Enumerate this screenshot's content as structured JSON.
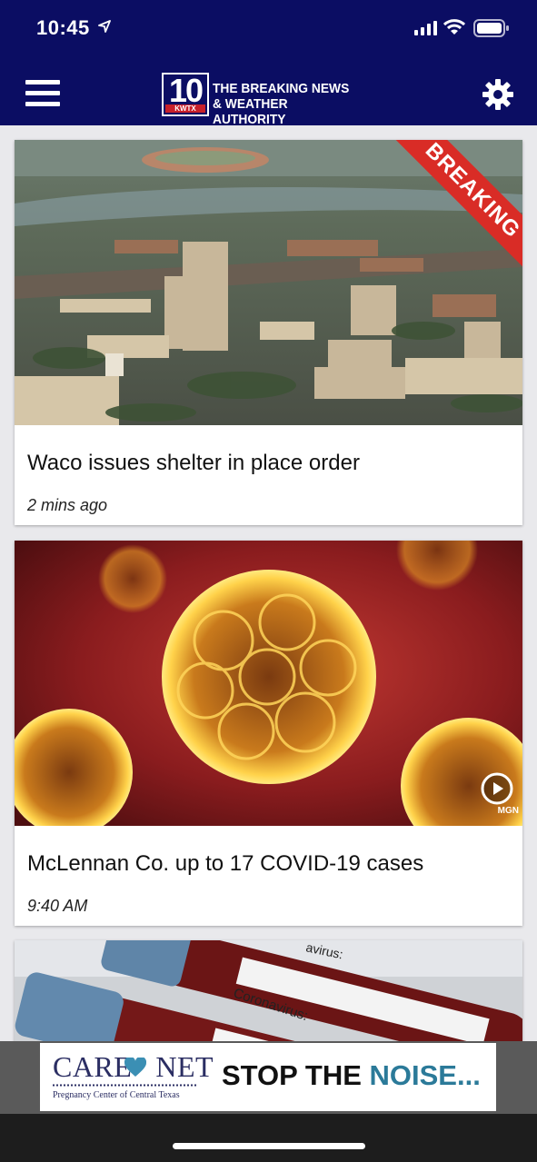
{
  "status_bar": {
    "time": "10:45"
  },
  "header": {
    "logo_number": "10",
    "logo_station": "KWTX",
    "logo_line1": "THE BREAKING NEWS",
    "logo_line2": "& WEATHER AUTHORITY",
    "menu_icon": "hamburger-menu-icon",
    "settings_icon": "gear-icon",
    "colors": {
      "bar": "#0b0d63",
      "breaking": "#d92c26"
    }
  },
  "stories": [
    {
      "badge": "BREAKING",
      "title": "Waco issues shelter in place order",
      "time": "2 mins ago"
    },
    {
      "title": "McLennan Co. up to 17 COVID-19 cases",
      "time": "9:40 AM",
      "video_icon": "play-icon",
      "image_credit": "MGN"
    },
    {
      "image_labels": [
        "Coronavirus:",
        "avirus:"
      ]
    }
  ],
  "ad": {
    "brand_part1": "CARE",
    "brand_part2": "NET",
    "brand_sub": "Pregnancy Center of Central Texas",
    "text_part1": "STOP THE ",
    "text_part2": "NOISE..."
  }
}
